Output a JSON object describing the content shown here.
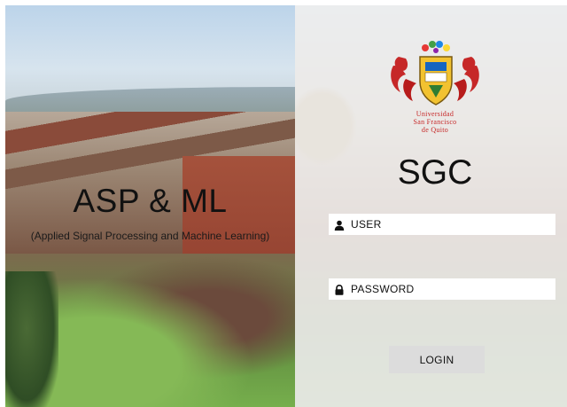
{
  "left_panel": {
    "title": "ASP & ML",
    "subtitle": "(Applied Signal Processing and Machine Learning)"
  },
  "right_panel": {
    "logo_icon": "university-crest-icon",
    "university_name": [
      "Universidad",
      "San Francisco",
      "de Quito"
    ],
    "app_title": "SGC",
    "user_field": {
      "icon": "user-icon",
      "placeholder": "USER"
    },
    "password_field": {
      "icon": "lock-icon",
      "placeholder": "PASSWORD"
    },
    "login_button": "LOGIN"
  },
  "colors": {
    "logo_red": "#c62828",
    "logo_gold": "#f2c230",
    "button_bg": "#dcdcdc",
    "field_bg": "#ffffff"
  }
}
